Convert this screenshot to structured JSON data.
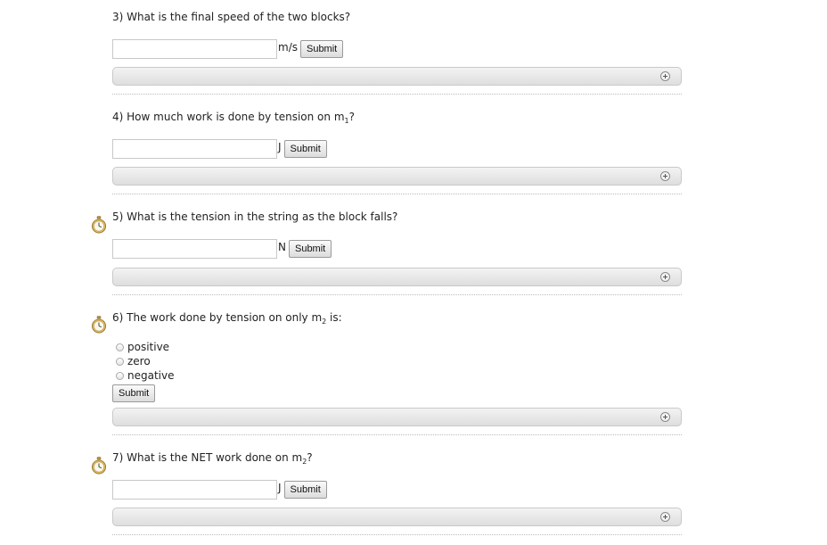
{
  "questions": [
    {
      "number": "3)",
      "text": "What is the final speed of the two blocks?",
      "unit": "m/s",
      "submit_label": "Submit",
      "has_timer": false
    },
    {
      "number": "4)",
      "text_before": "How much work is done by tension on m",
      "subscript": "1",
      "text_after": "?",
      "unit": "J",
      "submit_label": "Submit",
      "has_timer": false
    },
    {
      "number": "5)",
      "text": "What is the tension in the string as the block falls?",
      "unit": "N",
      "submit_label": "Submit",
      "has_timer": true
    },
    {
      "number": "6)",
      "text_before": "The work done by tension on only m",
      "subscript": "2",
      "text_after": " is:",
      "options": [
        "positive",
        "zero",
        "negative"
      ],
      "submit_label": "Submit",
      "has_timer": true
    },
    {
      "number": "7)",
      "text_before": "What is the NET work done on m",
      "subscript": "2",
      "text_after": "?",
      "unit": "J",
      "submit_label": "Submit",
      "has_timer": true
    }
  ],
  "icons": {
    "timer": "stopwatch-icon",
    "expand": "plus-circle-icon"
  },
  "colors": {
    "hint_bar_top": "#f3f3f3",
    "hint_bar_bottom": "#dedede",
    "timer_gold": "#c9a64a"
  }
}
